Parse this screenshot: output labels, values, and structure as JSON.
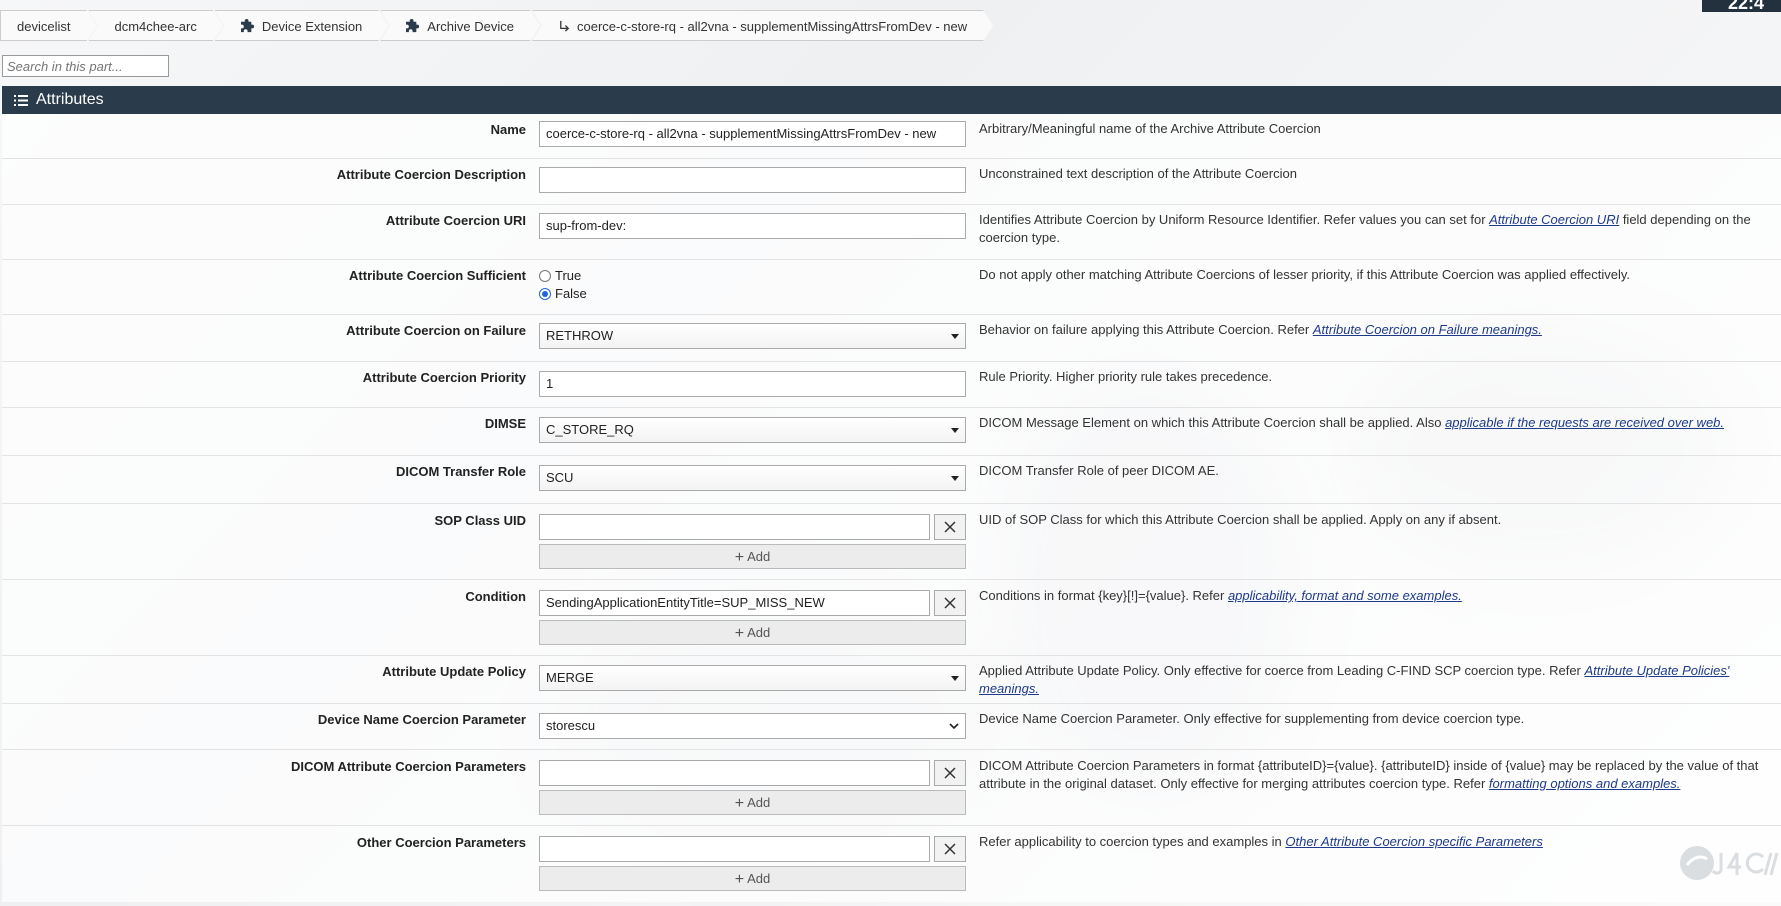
{
  "breadcrumbs": [
    {
      "label": "devicelist",
      "icon": ""
    },
    {
      "label": "dcm4chee-arc",
      "icon": ""
    },
    {
      "label": "Device Extension",
      "icon": "puzzle-icon"
    },
    {
      "label": "Archive Device",
      "icon": "puzzle-icon"
    },
    {
      "label": "coerce-c-store-rq - all2vna - supplementMissingAttrsFromDev - new",
      "icon": "child-arrow-icon"
    }
  ],
  "clock": "22:4",
  "search": {
    "placeholder": "Search in this part..."
  },
  "section": {
    "title": "Attributes"
  },
  "add_label": "Add",
  "rows": {
    "name": {
      "label": "Name",
      "value": "coerce-c-store-rq - all2vna - supplementMissingAttrsFromDev - new",
      "desc": "Arbitrary/Meaningful name of the Archive Attribute Coercion"
    },
    "description": {
      "label": "Attribute Coercion Description",
      "value": "",
      "desc": "Unconstrained text description of the Attribute Coercion"
    },
    "uri": {
      "label": "Attribute Coercion URI",
      "value": "sup-from-dev:",
      "desc_pre": "Identifies Attribute Coercion by Uniform Resource Identifier. Refer values you can set for ",
      "desc_link": "Attribute Coercion URI",
      "desc_post": " field depending on the coercion type."
    },
    "sufficient": {
      "label": "Attribute Coercion Sufficient",
      "options": [
        "True",
        "False"
      ],
      "selected": "False",
      "desc": "Do not apply other matching Attribute Coercions of lesser priority, if this Attribute Coercion was applied effectively."
    },
    "on_failure": {
      "label": "Attribute Coercion on Failure",
      "value": "RETHROW",
      "desc_pre": "Behavior on failure applying this Attribute Coercion. Refer ",
      "desc_link": "Attribute Coercion on Failure meanings."
    },
    "priority": {
      "label": "Attribute Coercion Priority",
      "value": "1",
      "desc": "Rule Priority. Higher priority rule takes precedence."
    },
    "dimse": {
      "label": "DIMSE",
      "value": "C_STORE_RQ",
      "desc_pre": "DICOM Message Element on which this Attribute Coercion shall be applied. Also ",
      "desc_link": "applicable if the requests are received over web."
    },
    "transfer_role": {
      "label": "DICOM Transfer Role",
      "value": "SCU",
      "desc": "DICOM Transfer Role of peer DICOM AE."
    },
    "sop_class": {
      "label": "SOP Class UID",
      "value": "",
      "desc": "UID of SOP Class for which this Attribute Coercion shall be applied. Apply on any if absent."
    },
    "condition": {
      "label": "Condition",
      "value": "SendingApplicationEntityTitle=SUP_MISS_NEW",
      "desc_pre": "Conditions in format {key}[!]={value}. Refer ",
      "desc_link": "applicability, format and some examples."
    },
    "update_policy": {
      "label": "Attribute Update Policy",
      "value": "MERGE",
      "desc_pre": "Applied Attribute Update Policy. Only effective for coerce from Leading C-FIND SCP coercion type. Refer ",
      "desc_link": "Attribute Update Policies' meanings."
    },
    "device_name": {
      "label": "Device Name Coercion Parameter",
      "value": "storescu",
      "desc": "Device Name Coercion Parameter. Only effective for supplementing from device coercion type."
    },
    "dicom_params": {
      "label": "DICOM Attribute Coercion Parameters",
      "value": "",
      "desc_pre": "DICOM Attribute Coercion Parameters in format {attributeID}={value}. {attributeID} inside of {value} may be replaced by the value of that attribute in the original dataset. Only effective for merging attributes coercion type. Refer ",
      "desc_link": "formatting options and examples."
    },
    "other_params": {
      "label": "Other Coercion Parameters",
      "value": "",
      "desc_pre": "Refer applicability to coercion types and examples in ",
      "desc_link": "Other Attribute Coercion specific Parameters"
    }
  },
  "colors": {
    "header_bg": "#2a3b4c",
    "link": "#1e3a8a",
    "radio_on": "#2264d6"
  }
}
